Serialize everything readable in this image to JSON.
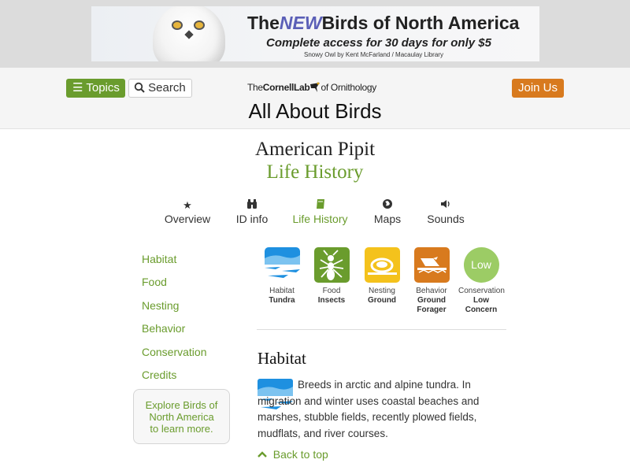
{
  "ad": {
    "title_pre": "The",
    "title_new": "NEW",
    "title_post": "Birds of North America",
    "subtitle": "Complete access for 30 days for only $5",
    "credit": "Snowy Owl by Kent McFarland / Macaulay Library"
  },
  "header": {
    "topics_label": "Topics",
    "search_label": "Search",
    "join_label": "Join Us",
    "lab_pre": "The",
    "lab_name": "Cornell",
    "lab_mid": "Lab",
    "lab_post": "of Ornithology",
    "site_title": "All About Birds"
  },
  "page": {
    "species": "American Pipit",
    "subpage": "Life History"
  },
  "tabs": [
    {
      "label": "Overview",
      "icon": "star-icon",
      "glyph": "★"
    },
    {
      "label": "ID info",
      "icon": "binoculars-icon",
      "glyph": "⌘"
    },
    {
      "label": "Life History",
      "icon": "book-icon",
      "glyph": "▮"
    },
    {
      "label": "Maps",
      "icon": "globe-icon",
      "glyph": "◉"
    },
    {
      "label": "Sounds",
      "icon": "speaker-icon",
      "glyph": "◀"
    }
  ],
  "sidebar": {
    "items": [
      "Habitat",
      "Food",
      "Nesting",
      "Behavior",
      "Conservation",
      "Credits"
    ],
    "explore": [
      "Explore Birds of",
      "North America",
      "to learn more."
    ]
  },
  "cards": [
    {
      "label": "Habitat",
      "value": "Tundra",
      "icon": "tundra-icon"
    },
    {
      "label": "Food",
      "value": "Insects",
      "icon": "insect-icon"
    },
    {
      "label": "Nesting",
      "value": "Ground",
      "icon": "ground-nest-icon"
    },
    {
      "label": "Behavior",
      "value": "Ground Forager",
      "value_l1": "Ground",
      "value_l2": "Forager",
      "icon": "forager-icon"
    },
    {
      "label": "Conservation",
      "value": "Low Concern",
      "value_l1": "Low",
      "value_l2": "Concern",
      "badge": "Low",
      "icon": "conservation-icon"
    }
  ],
  "habitat": {
    "title": "Habitat",
    "text": "Breeds in arctic and alpine tundra. In migration and winter uses coastal beaches and marshes, stubble fields, recently plowed fields, mudflats, and river courses.",
    "back_to_top": "Back to top"
  },
  "colors": {
    "green": "#6a9c2d",
    "orange": "#d87a1e",
    "yellow": "#f4c21c",
    "light_green": "#9ccc65"
  }
}
